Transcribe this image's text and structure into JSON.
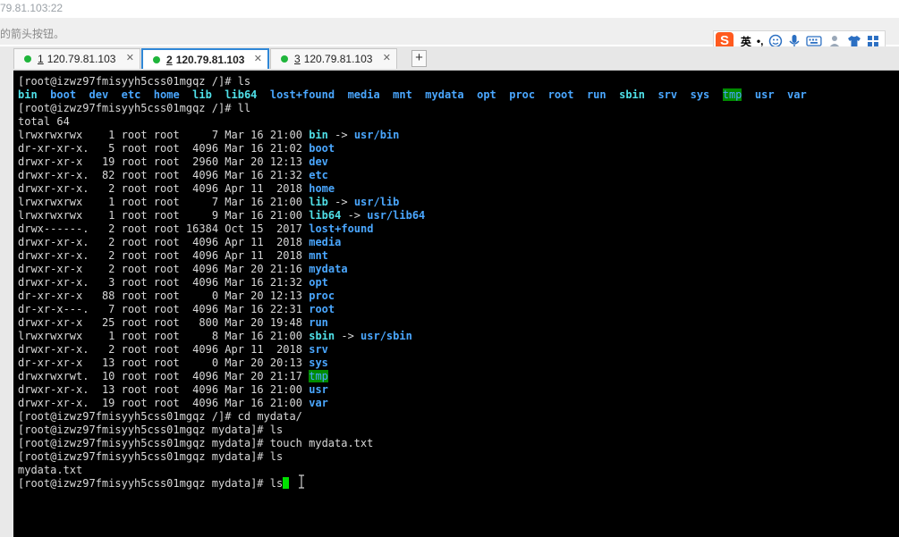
{
  "window": {
    "title_fragment": "79.81.103:22",
    "hint_fragment": "的箭头按钮。"
  },
  "tabs": [
    {
      "num": "1",
      "label": "120.79.81.103",
      "active": false
    },
    {
      "num": "2",
      "label": "120.79.81.103",
      "active": true
    },
    {
      "num": "3",
      "label": "120.79.81.103",
      "active": false
    }
  ],
  "tab_close": "✕",
  "tab_add": "+",
  "ime": {
    "lang": "英",
    "punct": "•,",
    "icons": [
      "emoji-icon",
      "microphone-icon",
      "keyboard-icon",
      "user-icon",
      "shirt-icon",
      "grid-icon"
    ]
  },
  "terminal": {
    "prompt_root": "[root@izwz97fmisyyh5css01mgqz /]# ",
    "prompt_mydata": "[root@izwz97fmisyyh5css01mgqz mydata]# ",
    "cmd1": "ls",
    "ls_root": [
      {
        "name": "bin",
        "type": "lnk"
      },
      {
        "name": "boot",
        "type": "dir"
      },
      {
        "name": "dev",
        "type": "dir"
      },
      {
        "name": "etc",
        "type": "dir"
      },
      {
        "name": "home",
        "type": "dir"
      },
      {
        "name": "lib",
        "type": "lnk"
      },
      {
        "name": "lib64",
        "type": "lnk"
      },
      {
        "name": "lost+found",
        "type": "dir"
      },
      {
        "name": "media",
        "type": "dir"
      },
      {
        "name": "mnt",
        "type": "dir"
      },
      {
        "name": "mydata",
        "type": "dir"
      },
      {
        "name": "opt",
        "type": "dir"
      },
      {
        "name": "proc",
        "type": "dir"
      },
      {
        "name": "root",
        "type": "dir"
      },
      {
        "name": "run",
        "type": "dir"
      },
      {
        "name": "sbin",
        "type": "lnk"
      },
      {
        "name": "srv",
        "type": "dir"
      },
      {
        "name": "sys",
        "type": "dir"
      },
      {
        "name": "tmp",
        "type": "tmp"
      },
      {
        "name": "usr",
        "type": "dir"
      },
      {
        "name": "var",
        "type": "dir"
      }
    ],
    "cmd2": "ll",
    "total": "total 64",
    "ll": [
      {
        "perm": "lrwxrwxrwx ",
        "links": "  1",
        "user": "root",
        "group": "root",
        "size": "    7",
        "date": "Mar 16 21:00",
        "name": "bin",
        "type": "lnk",
        "target": "usr/bin"
      },
      {
        "perm": "dr-xr-xr-x.",
        "links": "  5",
        "user": "root",
        "group": "root",
        "size": " 4096",
        "date": "Mar 16 21:02",
        "name": "boot",
        "type": "dir",
        "target": ""
      },
      {
        "perm": "drwxr-xr-x ",
        "links": " 19",
        "user": "root",
        "group": "root",
        "size": " 2960",
        "date": "Mar 20 12:13",
        "name": "dev",
        "type": "dir",
        "target": ""
      },
      {
        "perm": "drwxr-xr-x.",
        "links": " 82",
        "user": "root",
        "group": "root",
        "size": " 4096",
        "date": "Mar 16 21:32",
        "name": "etc",
        "type": "dir",
        "target": ""
      },
      {
        "perm": "drwxr-xr-x.",
        "links": "  2",
        "user": "root",
        "group": "root",
        "size": " 4096",
        "date": "Apr 11  2018",
        "name": "home",
        "type": "dir",
        "target": ""
      },
      {
        "perm": "lrwxrwxrwx ",
        "links": "  1",
        "user": "root",
        "group": "root",
        "size": "    7",
        "date": "Mar 16 21:00",
        "name": "lib",
        "type": "lnk",
        "target": "usr/lib"
      },
      {
        "perm": "lrwxrwxrwx ",
        "links": "  1",
        "user": "root",
        "group": "root",
        "size": "    9",
        "date": "Mar 16 21:00",
        "name": "lib64",
        "type": "lnk",
        "target": "usr/lib64"
      },
      {
        "perm": "drwx------.",
        "links": "  2",
        "user": "root",
        "group": "root",
        "size": "16384",
        "date": "Oct 15  2017",
        "name": "lost+found",
        "type": "dir",
        "target": ""
      },
      {
        "perm": "drwxr-xr-x.",
        "links": "  2",
        "user": "root",
        "group": "root",
        "size": " 4096",
        "date": "Apr 11  2018",
        "name": "media",
        "type": "dir",
        "target": ""
      },
      {
        "perm": "drwxr-xr-x.",
        "links": "  2",
        "user": "root",
        "group": "root",
        "size": " 4096",
        "date": "Apr 11  2018",
        "name": "mnt",
        "type": "dir",
        "target": ""
      },
      {
        "perm": "drwxr-xr-x ",
        "links": "  2",
        "user": "root",
        "group": "root",
        "size": " 4096",
        "date": "Mar 20 21:16",
        "name": "mydata",
        "type": "dir",
        "target": ""
      },
      {
        "perm": "drwxr-xr-x.",
        "links": "  3",
        "user": "root",
        "group": "root",
        "size": " 4096",
        "date": "Mar 16 21:32",
        "name": "opt",
        "type": "dir",
        "target": ""
      },
      {
        "perm": "dr-xr-xr-x ",
        "links": " 88",
        "user": "root",
        "group": "root",
        "size": "    0",
        "date": "Mar 20 12:13",
        "name": "proc",
        "type": "dir",
        "target": ""
      },
      {
        "perm": "dr-xr-x---.",
        "links": "  7",
        "user": "root",
        "group": "root",
        "size": " 4096",
        "date": "Mar 16 22:31",
        "name": "root",
        "type": "dir",
        "target": ""
      },
      {
        "perm": "drwxr-xr-x ",
        "links": " 25",
        "user": "root",
        "group": "root",
        "size": "  800",
        "date": "Mar 20 19:48",
        "name": "run",
        "type": "dir",
        "target": ""
      },
      {
        "perm": "lrwxrwxrwx ",
        "links": "  1",
        "user": "root",
        "group": "root",
        "size": "    8",
        "date": "Mar 16 21:00",
        "name": "sbin",
        "type": "lnk",
        "target": "usr/sbin"
      },
      {
        "perm": "drwxr-xr-x.",
        "links": "  2",
        "user": "root",
        "group": "root",
        "size": " 4096",
        "date": "Apr 11  2018",
        "name": "srv",
        "type": "dir",
        "target": ""
      },
      {
        "perm": "dr-xr-xr-x ",
        "links": " 13",
        "user": "root",
        "group": "root",
        "size": "    0",
        "date": "Mar 20 20:13",
        "name": "sys",
        "type": "dir",
        "target": ""
      },
      {
        "perm": "drwxrwxrwt.",
        "links": " 10",
        "user": "root",
        "group": "root",
        "size": " 4096",
        "date": "Mar 20 21:17",
        "name": "tmp",
        "type": "tmp",
        "target": ""
      },
      {
        "perm": "drwxr-xr-x.",
        "links": " 13",
        "user": "root",
        "group": "root",
        "size": " 4096",
        "date": "Mar 16 21:00",
        "name": "usr",
        "type": "dir",
        "target": ""
      },
      {
        "perm": "drwxr-xr-x.",
        "links": " 19",
        "user": "root",
        "group": "root",
        "size": " 4096",
        "date": "Mar 16 21:00",
        "name": "var",
        "type": "dir",
        "target": ""
      }
    ],
    "cmd3": "cd mydata/",
    "cmd4": "ls",
    "cmd5": "touch mydata.txt",
    "cmd6": "ls",
    "ls_mydata": "mydata.txt",
    "cmd7": "ls",
    "link_arrow": " -> "
  },
  "colors": {
    "dir": "#4aa7ff",
    "lnk": "#4fe0e8",
    "tmp_bg": "#008b00",
    "tab_active": "#2f87d6",
    "status_dot": "#1fb53b"
  }
}
